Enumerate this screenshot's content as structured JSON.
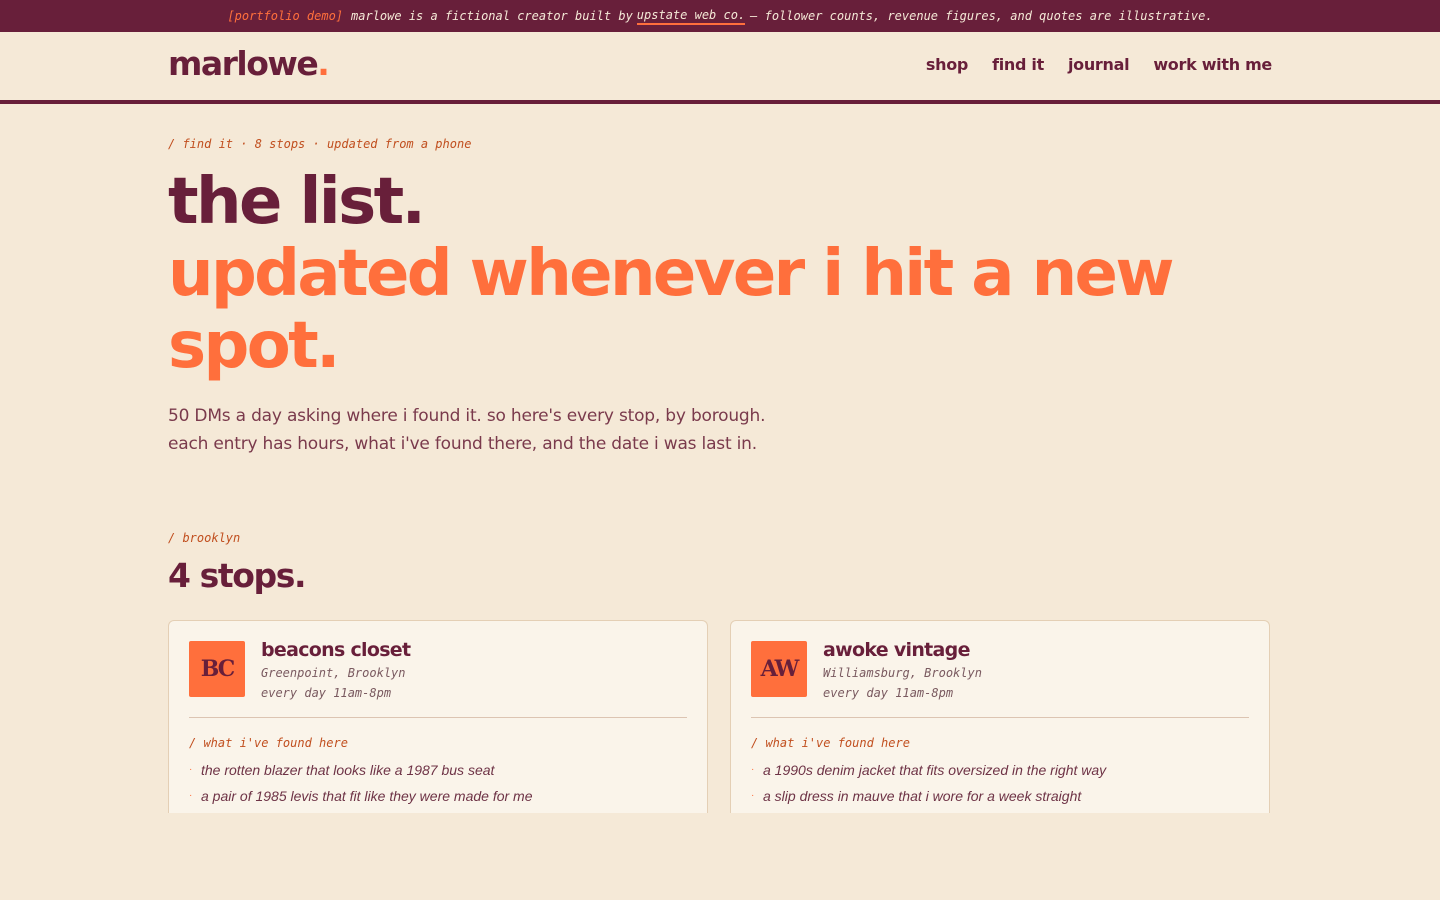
{
  "banner": {
    "tag": "[portfolio demo]",
    "before": "marlowe is a fictional creator built by",
    "link": "upstate web co.",
    "after": "— follower counts, revenue figures, and quotes are illustrative."
  },
  "header": {
    "logo": "marlowe",
    "logo_dot": ".",
    "nav": [
      "shop",
      "find it",
      "journal",
      "work with me"
    ]
  },
  "hero": {
    "eyebrow": "/ find it · 8 stops · updated from a phone",
    "title_line1": "the list.",
    "title_line2": "updated whenever i hit a new spot.",
    "intro": "50 DMs a day asking where i found it. so here's every stop, by borough. each entry has hours, what i've found there, and the date i was last in."
  },
  "section": {
    "eyebrow": "/ brooklyn",
    "title": "4 stops."
  },
  "stores": [
    {
      "initials": "BC",
      "name": "beacons closet",
      "location": "Greenpoint, Brooklyn",
      "hours": "every day 11am-8pm",
      "found_title": "/ what i've found here",
      "found": [
        "the rotten blazer that looks like a 1987 bus seat",
        "a pair of 1985 levis that fit like they were made for me"
      ]
    },
    {
      "initials": "AW",
      "name": "awoke vintage",
      "location": "Williamsburg, Brooklyn",
      "hours": "every day 11am-8pm",
      "found_title": "/ what i've found here",
      "found": [
        "a 1990s denim jacket that fits oversized in the right way",
        "a slip dress in mauve that i wore for a week straight"
      ]
    }
  ],
  "colors": {
    "plum": "#681f3a",
    "orange": "#ff6f3c",
    "cream": "#f5e9d7",
    "card": "#faf4ea"
  }
}
